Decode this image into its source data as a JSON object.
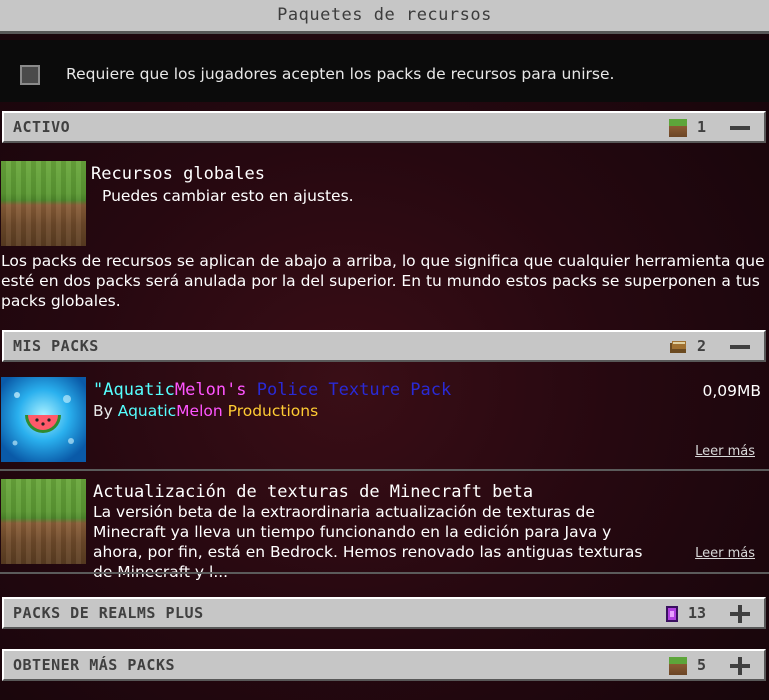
{
  "header": {
    "title": "Paquetes de recursos"
  },
  "require": {
    "label": "Requiere que los jugadores acepten los packs de recursos para unirse."
  },
  "active": {
    "label": "ACTIVO",
    "count": "1",
    "icon": "grass-block-icon"
  },
  "global": {
    "title": "Recursos globales",
    "subtitle": "Puedes cambiar esto en ajustes."
  },
  "info": {
    "text": "Los packs de recursos se aplican de abajo a arriba, lo que significa que cualquier herramienta que esté en dos packs será anulada por la del superior. En tu mundo estos packs se superponen a tus packs globales."
  },
  "mypacks": {
    "label": "MIS PACKS",
    "count": "2",
    "icon": "book-icon"
  },
  "packs": [
    {
      "title_parts": [
        "\"Aquatic",
        "Melon's",
        " Police Texture Pack"
      ],
      "title_colors": [
        "#55ffff",
        "#ff55ff",
        "#2a2ad6"
      ],
      "by": "By",
      "author_parts": [
        "Aquatic",
        "Melon",
        " Productions"
      ],
      "author_colors": [
        "#55ffff",
        "#ff55ff",
        "#ffcc33"
      ],
      "size": "0,09MB",
      "more": "Leer más"
    },
    {
      "title": "Actualización de texturas de Minecraft beta",
      "description": "La versión beta de la extraordinaria actualización de texturas de Minecraft ya lleva un tiempo funcionando en la edición para Java y ahora, por fin, está en Bedrock. Hemos renovado las antiguas texturas de Minecraft y l...",
      "more": "Leer más"
    }
  ],
  "realms": {
    "label": "PACKS DE REALMS PLUS",
    "count": "13",
    "icon": "realms-icon"
  },
  "getmore": {
    "label": "OBTENER MÁS PACKS",
    "count": "5",
    "icon": "grass-block-icon"
  }
}
